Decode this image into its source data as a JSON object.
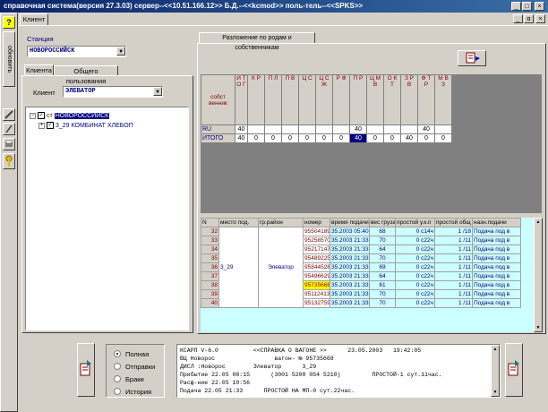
{
  "window": {
    "title": "справочная система(версия 27.3.03) сервер--<<10.51.166.12>> Б.Д.--<<kcmod>> поль-тель--<<SPKS>>",
    "controls": [
      "_",
      "□",
      "×"
    ],
    "inner_controls": [
      "_",
      "ɑ",
      "×"
    ]
  },
  "toolbar": {
    "help_label": "?",
    "refresh_label": "обновить"
  },
  "top_tab": "Клиент",
  "left": {
    "station_label": "Станция",
    "station_value": "НОВОРОССИЙСК",
    "tabs": [
      "Клиента",
      "Общего пользования"
    ],
    "client_label": "Клиент",
    "client_value": "ЭЛЕВАТОР",
    "tree": [
      {
        "prefix": "ст",
        "label": "НОВОРОССИЙСК"
      },
      {
        "prefix": "",
        "label": "3_29 КОМБИНАТ ХЛЕБОП"
      }
    ]
  },
  "right": {
    "group_title": "Разложение по родам и собственникам",
    "matrix": {
      "header_label": "собст венник",
      "columns": [
        "И Т О Г",
        "К Р",
        "П Л",
        "П В",
        "Ц С",
        "Ц С Ж",
        "Р Ф",
        "П Р",
        "Ц М В",
        "О К Т",
        "З Р В",
        "Ф Т Р",
        "М В З"
      ],
      "rows": [
        {
          "label": "RU",
          "values": [
            "40",
            "",
            "",
            "",
            "",
            "",
            "",
            "40",
            "",
            "",
            "",
            "40",
            ""
          ]
        },
        {
          "label": "ИТОГО",
          "values": [
            "40",
            "0",
            "0",
            "0",
            "0",
            "0",
            "0",
            "40",
            "0",
            "0",
            "40",
            "0",
            "0"
          ]
        }
      ]
    },
    "wagons": {
      "headers": [
        "N",
        "место под.",
        "гр.район",
        "номер",
        "время подачи",
        "вес груза",
        "простой у.к.п",
        "простой общ",
        "назн.подачи"
      ],
      "group_place": "3_29",
      "group_district": "Элеватор",
      "rows": [
        [
          "32",
          "95504189",
          "35.2003 05:40",
          "68",
          "0 с14ч",
          "1 /18",
          "Подача под в"
        ],
        [
          "33",
          "95258570",
          "35.2003 21:33",
          "70",
          "0 с22ч",
          "1 /11",
          "Подача под в"
        ],
        [
          "34",
          "95217147",
          "35.2003 21:33",
          "64",
          "0 с22ч",
          "1 /11",
          "Подача под в"
        ],
        [
          "35",
          "95489225",
          "35.2003 21:33",
          "70",
          "0 с22ч",
          "1 /11",
          "Подача под в"
        ],
        [
          "36",
          "95844528",
          "35.2003 21:33",
          "69",
          "0 с22ч",
          "1 /11",
          "Подача под в"
        ],
        [
          "37",
          "95496629",
          "35.2003 21:33",
          "64",
          "0 с22ч",
          "1 /11",
          "Подача под в"
        ],
        [
          "38",
          "95735668",
          "35.2003 21:33",
          "61",
          "0 с22ч",
          "1 /11",
          "Подача под в"
        ],
        [
          "39",
          "95112413",
          "35.2003 21:33",
          "70",
          "0 с22ч",
          "1 /11",
          "Подача под в"
        ],
        [
          "40",
          "95132759",
          "35.2003 21:33",
          "70",
          "0 с22ч",
          "1 /11",
          "Подача под в"
        ]
      ],
      "highlight_number": "95735668"
    }
  },
  "bottom": {
    "radios": [
      "Полная",
      "Отправки",
      "Браки",
      "История"
    ],
    "selected_radio": "Полная",
    "report_lines": [
      "КСАРП V-6.0          <<СПРАВКА О ВАГОНЕ >>      23.05.2003   19:42:05",
      "ВЦ Новорос                 вагон- № 95735668",
      "ДИСЛ :Новорос        Элеватор      3_29",
      "Прибытие 22.05 08:15      (3001 5200 054 5210)         ПРОСТОЙ-1 сут.11час.",
      "Раcф-ние 22.05 10:56",
      "Подача 22.05 21:33      ПРОСТОЙ НА МП-0 сут.22час."
    ]
  },
  "colors": {
    "accent": "#0a246a",
    "window_bg": "#d4d0c8",
    "matrix_bg": "#808080",
    "cyan": "#ccffff",
    "highlight": "#ffff00",
    "maroon": "#800000"
  }
}
